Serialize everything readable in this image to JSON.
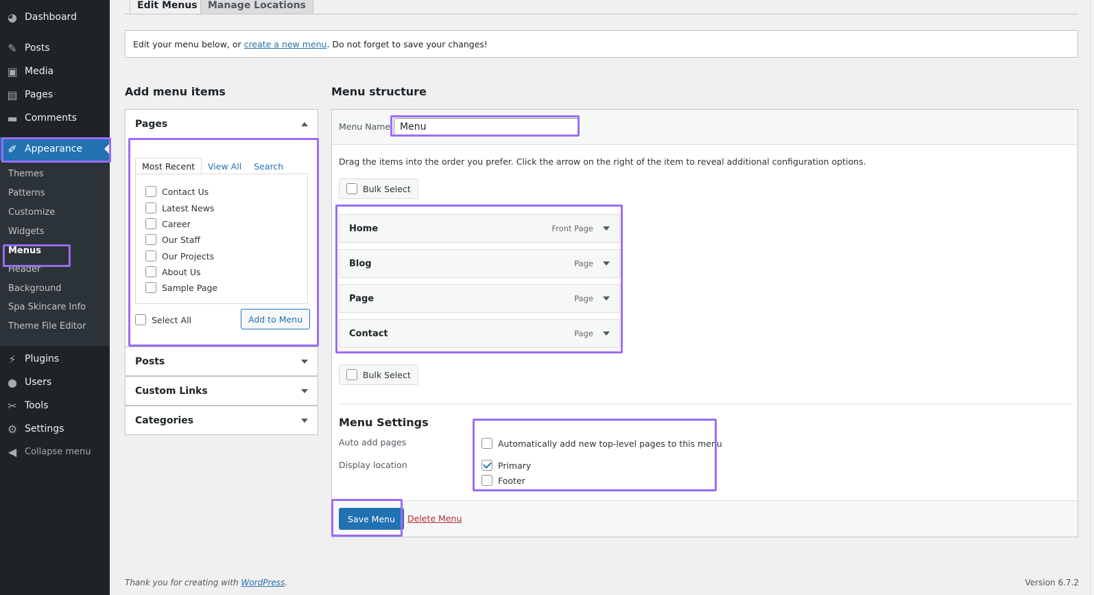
{
  "sidebar": {
    "items": [
      {
        "label": "Dashboard",
        "icon": "dashboard-icon",
        "glyph": "◕"
      },
      {
        "label": "Posts",
        "icon": "pin-icon",
        "glyph": "✎"
      },
      {
        "label": "Media",
        "icon": "media-icon",
        "glyph": "▣"
      },
      {
        "label": "Pages",
        "icon": "pages-icon",
        "glyph": "▤"
      },
      {
        "label": "Comments",
        "icon": "comment-icon",
        "glyph": "▬"
      },
      {
        "label": "Appearance",
        "icon": "paintbrush-icon",
        "glyph": "✐"
      }
    ],
    "appearance_submenu": [
      "Themes",
      "Patterns",
      "Customize",
      "Widgets",
      "Menus",
      "Header",
      "Background",
      "Spa Skincare Info",
      "Theme File Editor"
    ],
    "lower_items": [
      {
        "label": "Plugins",
        "icon": "plugin-icon",
        "glyph": "⚡"
      },
      {
        "label": "Users",
        "icon": "user-icon",
        "glyph": "●"
      },
      {
        "label": "Tools",
        "icon": "wrench-icon",
        "glyph": "✂"
      },
      {
        "label": "Settings",
        "icon": "settings-icon",
        "glyph": "⚙"
      }
    ],
    "collapse_label": "Collapse menu"
  },
  "tabs": {
    "edit": "Edit Menus",
    "manage": "Manage Locations"
  },
  "notice": {
    "before": "Edit your menu below, or ",
    "link": "create a new menu",
    "after": ". Do not forget to save your changes!"
  },
  "add_items": {
    "heading": "Add menu items",
    "pages_title": "Pages",
    "inner_tabs": [
      "Most Recent",
      "View All",
      "Search"
    ],
    "pages": [
      "Contact Us",
      "Latest News",
      "Career",
      "Our Staff",
      "Our Projects",
      "About Us",
      "Sample Page"
    ],
    "select_all": "Select All",
    "add_button": "Add to Menu",
    "other_sections": [
      "Posts",
      "Custom Links",
      "Categories"
    ]
  },
  "structure": {
    "heading": "Menu structure",
    "name_label": "Menu Name",
    "name_value": "Menu",
    "instructions": "Drag the items into the order you prefer. Click the arrow on the right of the item to reveal additional configuration options.",
    "bulk_select": "Bulk Select",
    "items": [
      {
        "title": "Home",
        "type": "Front Page"
      },
      {
        "title": "Blog",
        "type": "Page"
      },
      {
        "title": "Page",
        "type": "Page"
      },
      {
        "title": "Contact",
        "type": "Page"
      }
    ],
    "settings_heading": "Menu Settings",
    "auto_add_label": "Auto add pages",
    "auto_add_option": "Automatically add new top-level pages to this menu",
    "display_location_label": "Display location",
    "locations": [
      {
        "label": "Primary",
        "checked": true
      },
      {
        "label": "Footer",
        "checked": false
      }
    ],
    "save_button": "Save Menu",
    "delete_link": "Delete Menu"
  },
  "footer": {
    "thanks_before": "Thank you for creating with ",
    "thanks_link": "WordPress",
    "thanks_after": ".",
    "version": "Version 6.7.2"
  },
  "colors": {
    "highlight": "#9b6cf5",
    "primary": "#2271b1",
    "sidebar": "#1d2327"
  }
}
